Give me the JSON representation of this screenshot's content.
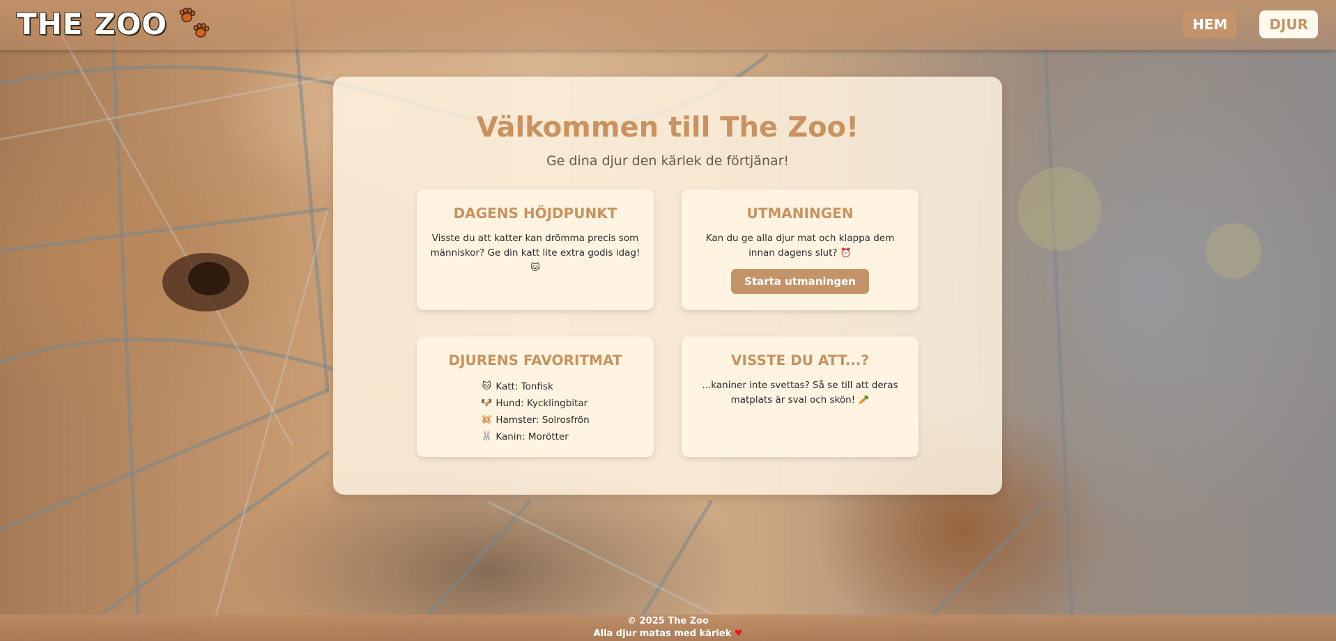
{
  "header": {
    "logo_text": "THE ZOO",
    "nav": [
      {
        "label": "HEM",
        "active": true
      },
      {
        "label": "DJUR",
        "active": false
      }
    ]
  },
  "main": {
    "title": "Välkommen till The Zoo!",
    "subtitle": "Ge dina djur den kärlek de förtjänar!",
    "cards": [
      {
        "title": "DAGENS HÖJDPUNKT",
        "text": "Visste du att katter kan drömma precis som människor? Ge din katt lite extra godis idag!",
        "emoji": "🐱"
      },
      {
        "title": "UTMANINGEN",
        "text": "Kan du ge alla djur mat och klappa dem innan dagens slut?",
        "emoji": "⏰",
        "button_label": "Starta utmaningen"
      },
      {
        "title": "DJURENS FAVORITMAT",
        "items": [
          {
            "emoji": "🐱",
            "text": "Katt: Tonfisk"
          },
          {
            "emoji": "🐶",
            "text": "Hund: Kycklingbitar"
          },
          {
            "emoji": "🐹",
            "text": "Hamster: Solrosfrön"
          },
          {
            "emoji": "🐰",
            "text": "Kanin: Morötter"
          }
        ]
      },
      {
        "title": "VISSTE DU ATT...?",
        "text": "...kaniner inte svettas? Så se till att deras matplats är sval och skön!",
        "emoji": "🥕"
      }
    ]
  },
  "footer": {
    "copyright": "© 2025 The Zoo",
    "tagline": "Alla djur matas med kärlek",
    "heart": "♥"
  },
  "colors": {
    "accent": "#c4936a",
    "title": "#c9925e",
    "card_bg": "#fff4e2"
  },
  "icons": {
    "logo": "paw-prints-icon",
    "heart": "heart-icon"
  }
}
